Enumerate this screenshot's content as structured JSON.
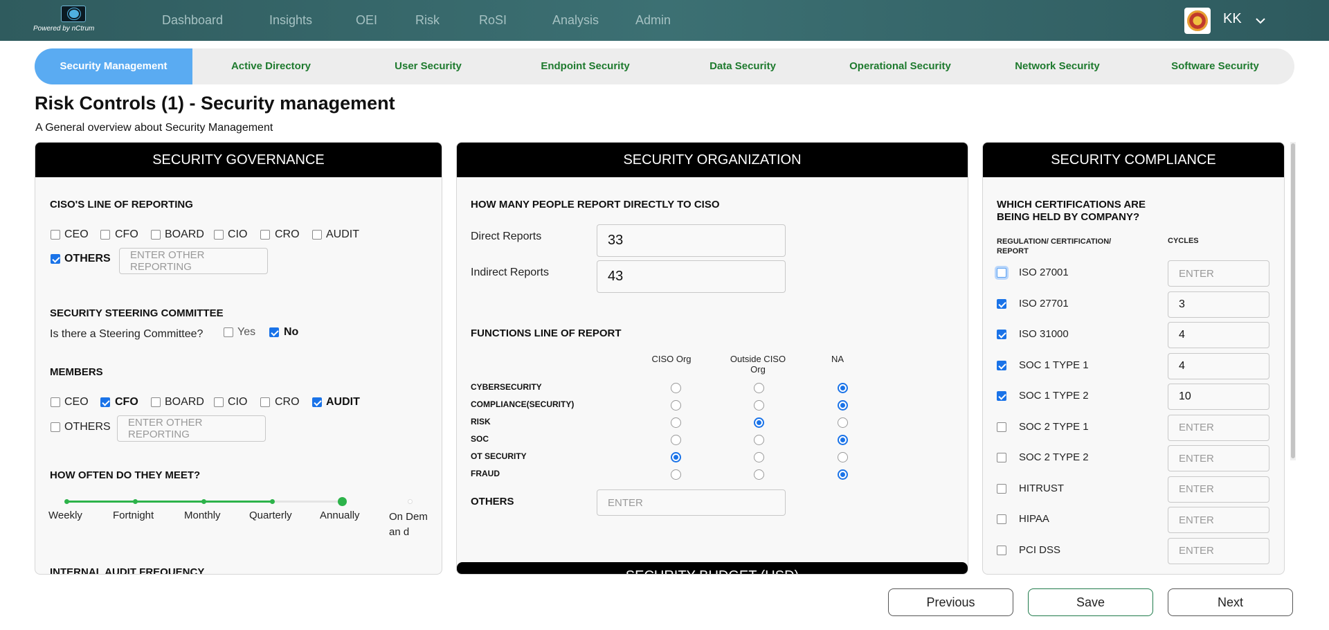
{
  "topbar": {
    "powered_by": "Powered by nCtrum",
    "nav": [
      "Dashboard",
      "Insights",
      "OEI",
      "Risk",
      "RoSI",
      "Analysis",
      "Admin"
    ],
    "user_initials": "KK"
  },
  "tabs": [
    "Security Management",
    "Active Directory",
    "User Security",
    "Endpoint Security",
    "Data Security",
    "Operational Security",
    "Network Security",
    "Software Security"
  ],
  "page": {
    "title": "Risk Controls (1) - Security management",
    "subtitle": "A General overview about Security Management"
  },
  "governance": {
    "header": "SECURITY GOVERNANCE",
    "ciso_reporting_title": "CISO'S LINE OF REPORTING",
    "ciso_reporting": [
      {
        "label": "CEO",
        "checked": false
      },
      {
        "label": "CFO",
        "checked": false
      },
      {
        "label": "BOARD",
        "checked": false
      },
      {
        "label": "CIO",
        "checked": false
      },
      {
        "label": "CRO",
        "checked": false
      },
      {
        "label": "AUDIT",
        "checked": false
      },
      {
        "label": "OTHERS",
        "checked": true
      }
    ],
    "other_reporting_placeholder": "ENTER OTHER REPORTING",
    "steering_title": "SECURITY STEERING COMMITTEE",
    "steering_question": "Is there a Steering Committee?",
    "steering_yes": "Yes",
    "steering_no": "No",
    "steering_value": "No",
    "members_title": "MEMBERS",
    "members": [
      {
        "label": "CEO",
        "checked": false
      },
      {
        "label": "CFO",
        "checked": true
      },
      {
        "label": "BOARD",
        "checked": false
      },
      {
        "label": "CIO",
        "checked": false
      },
      {
        "label": "CRO",
        "checked": false
      },
      {
        "label": "AUDIT",
        "checked": true
      },
      {
        "label": "OTHERS",
        "checked": false
      }
    ],
    "members_other_placeholder": "ENTER OTHER REPORTING",
    "meet_title": "HOW OFTEN DO THEY MEET?",
    "meet_options": [
      "Weekly",
      "Fortnight",
      "Monthly",
      "Quarterly",
      "Annually",
      "On Deman d"
    ],
    "meet_selected_index": 4,
    "audit_title": "INTERNAL AUDIT FREQUENCY"
  },
  "organization": {
    "header": "SECURITY ORGANIZATION",
    "reports_title": "HOW MANY PEOPLE REPORT DIRECTLY TO CISO",
    "direct_label": "Direct Reports",
    "direct_value": "33",
    "indirect_label": "Indirect Reports",
    "indirect_value": "43",
    "functions_title": "FUNCTIONS LINE OF REPORT",
    "columns": [
      "CISO Org",
      "Outside CISO Org",
      "NA"
    ],
    "functions": [
      {
        "name": "CYBERSECURITY",
        "selected": 2
      },
      {
        "name": "COMPLIANCE(SECURITY)",
        "selected": 2
      },
      {
        "name": "RISK",
        "selected": 1
      },
      {
        "name": "SOC",
        "selected": 2
      },
      {
        "name": "OT SECURITY",
        "selected": 0
      },
      {
        "name": "FRAUD",
        "selected": 2
      }
    ],
    "others_label": "OTHERS",
    "others_placeholder": "ENTER",
    "budget_header": "SECURITY BUDGET (USD)"
  },
  "compliance": {
    "header": "SECURITY COMPLIANCE",
    "question": "WHICH CERTIFICATIONS ARE BEING HELD BY COMPANY?",
    "col_regulation": "REGULATION/ CERTIFICATION/ REPORT",
    "col_cycles": "CYCLES",
    "placeholder": "ENTER",
    "items": [
      {
        "name": "ISO 27001",
        "checked": false,
        "cycles": ""
      },
      {
        "name": "ISO 27701",
        "checked": true,
        "cycles": "3"
      },
      {
        "name": "ISO 31000",
        "checked": true,
        "cycles": "4"
      },
      {
        "name": "SOC 1 TYPE 1",
        "checked": true,
        "cycles": "4"
      },
      {
        "name": "SOC 1 TYPE 2",
        "checked": true,
        "cycles": "10"
      },
      {
        "name": "SOC 2 TYPE 1",
        "checked": false,
        "cycles": ""
      },
      {
        "name": "SOC 2 TYPE 2",
        "checked": false,
        "cycles": ""
      },
      {
        "name": "HITRUST",
        "checked": false,
        "cycles": ""
      },
      {
        "name": "HIPAA",
        "checked": false,
        "cycles": ""
      },
      {
        "name": "PCI DSS",
        "checked": false,
        "cycles": ""
      }
    ]
  },
  "footer": {
    "previous": "Previous",
    "save": "Save",
    "next": "Next"
  },
  "colors": {
    "accent": "#1a73e8",
    "tab_active": "#5aabf2",
    "tab_text": "#1e7a2e",
    "slider": "#2db34a",
    "topbar": "#35666a"
  }
}
